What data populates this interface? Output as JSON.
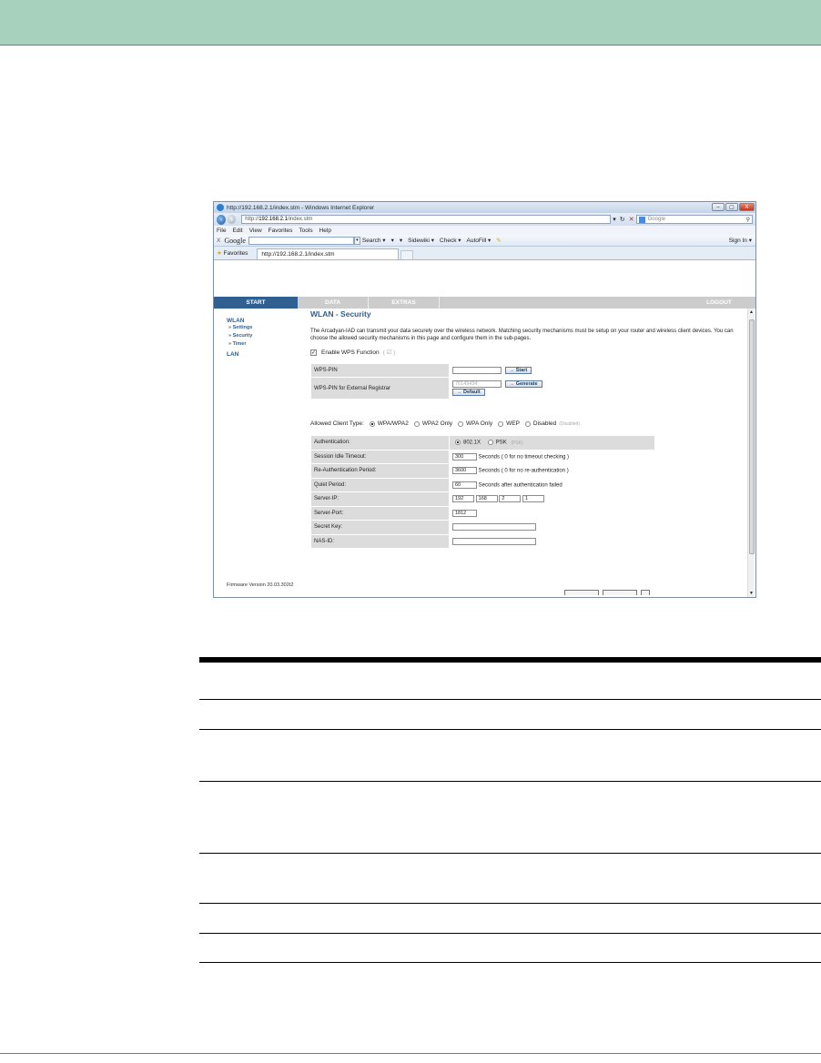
{
  "browser": {
    "window_title": "http://192.168.2.1/index.stm - Windows Internet Explorer",
    "window_buttons": [
      "–",
      "▢",
      "X"
    ],
    "address": {
      "prefix": "http://",
      "host": "192.168.2.1",
      "path": "/index.stm"
    },
    "search_placeholder": "Google",
    "menu": [
      "File",
      "Edit",
      "View",
      "Favorites",
      "Tools",
      "Help"
    ],
    "google_bar": {
      "close": "X",
      "logo": "Google",
      "items": [
        "Search ▾",
        "▾",
        "▾",
        "Sidewiki ▾",
        "Check ▾",
        "AutoFill ▾"
      ],
      "sign_in": "Sign In ▾"
    },
    "favorites_label": "Favorites",
    "tab_label": "http://192.168.2.1/index.stm"
  },
  "router": {
    "nav": {
      "start": "START",
      "data": "DATA",
      "extras": "EXTRAS",
      "logout": "LOGOUT"
    },
    "sidebar": {
      "wlan": "WLAN",
      "items": [
        "» Settings",
        "» Security",
        "» Timer"
      ],
      "lan": "LAN",
      "firmware": "Firmware Version 20.03.302t2"
    },
    "page_title": "WLAN - Security",
    "description": "The Arcadyan-IAD can transmit your data securely over the wireless network. Matching security mechanisms must be setup on your router and wireless client devices. You can choose the allowed security mechanisms in this page and configure them in the sub-pages.",
    "wps_checkbox": {
      "label": "Enable WPS Function",
      "hint": "( ☑ )",
      "checked": true
    },
    "wps_rows": {
      "pin_label": "WPS-PIN",
      "start_button": "Start",
      "external_label": "WPS-PIN for External Registrar",
      "external_value": "76149434",
      "generate_button": "Generate",
      "default_button": "Default"
    },
    "client_type": {
      "label": "Allowed Client Type:",
      "options": [
        "WPA/WPA2",
        "WPA2 Only",
        "WPA Only",
        "WEP",
        "Disabled"
      ],
      "selected": "WPA/WPA2",
      "hint": "(Disabled)"
    },
    "auth": {
      "authentication_label": "Authentication:",
      "auth_options": [
        "802.1X",
        "PSK"
      ],
      "psk_hint": "(PSK)",
      "session_label": "Session Idle Timeout:",
      "session_value": "300",
      "session_note": "Seconds ( 0 for no timeout checking )",
      "reauth_label": "Re-Authentication Period:",
      "reauth_value": "3600",
      "reauth_note": "Seconds ( 0 for no re-authentication )",
      "quiet_label": "Quiet Period:",
      "quiet_value": "60",
      "quiet_note": "Seconds after authentication failed",
      "server_ip_label": "Server-IP:",
      "server_ip": [
        "192",
        "168",
        "2",
        "1"
      ],
      "server_port_label": "Server-Port:",
      "server_port_value": "1812",
      "secret_label": "Secret Key:",
      "secret_value": "",
      "nas_label": "NAS-ID:",
      "nas_value": ""
    }
  },
  "colors": {
    "doc_header": "#a8d1bd",
    "router_blue": "#305f91",
    "nav_grey": "#cccccc"
  }
}
